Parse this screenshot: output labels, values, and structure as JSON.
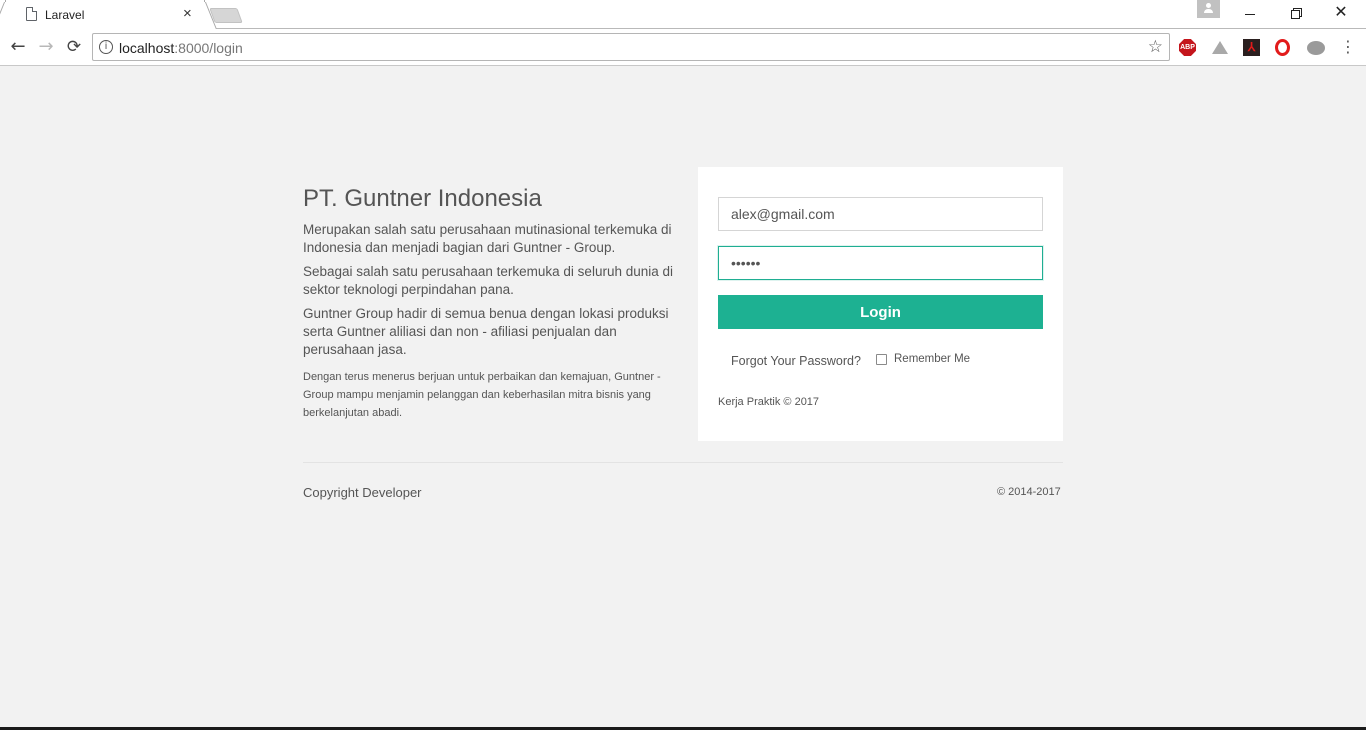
{
  "browser": {
    "tab_title": "Laravel",
    "tab_close": "×",
    "url_host": "localhost",
    "url_rest": ":8000/login",
    "back_glyph": "←",
    "forward_glyph": "→",
    "reload_glyph": "⟳",
    "star_glyph": "☆",
    "menu_glyph": "⋮",
    "close_glyph": "✕",
    "info_glyph": "i",
    "extensions": {
      "abp_label": "ABP",
      "pdf_label": "⅄"
    }
  },
  "intro": {
    "heading": "PT. Guntner Indonesia",
    "paragraphs": [
      "Merupakan salah satu perusahaan mutinasional terkemuka di Indonesia dan menjadi bagian dari Guntner - Group.",
      "Sebagai salah satu perusahaan terkemuka di seluruh dunia di sektor teknologi perpindahan pana.",
      "Guntner Group hadir di semua benua dengan lokasi produksi serta Guntner aliliasi dan non - afiliasi penjualan dan perusahaan jasa."
    ],
    "small_text": "Dengan terus menerus berjuan untuk perbaikan dan kemajuan, Guntner - Group mampu menjamin pelanggan dan keberhasilan mitra bisnis yang berkelanjutan abadi."
  },
  "login": {
    "email_value": "alex@gmail.com",
    "password_value": "••••••",
    "button_label": "Login",
    "forgot_label": "Forgot Your Password?",
    "remember_label": "Remember Me",
    "remember_checked": false,
    "card_footer": "Kerja Praktik © 2017"
  },
  "footer": {
    "left": "Copyright Developer",
    "right": "© 2014-2017"
  },
  "colors": {
    "accent": "#1db192",
    "page_bg": "#f2f2f2",
    "card_bg": "#ffffff"
  }
}
